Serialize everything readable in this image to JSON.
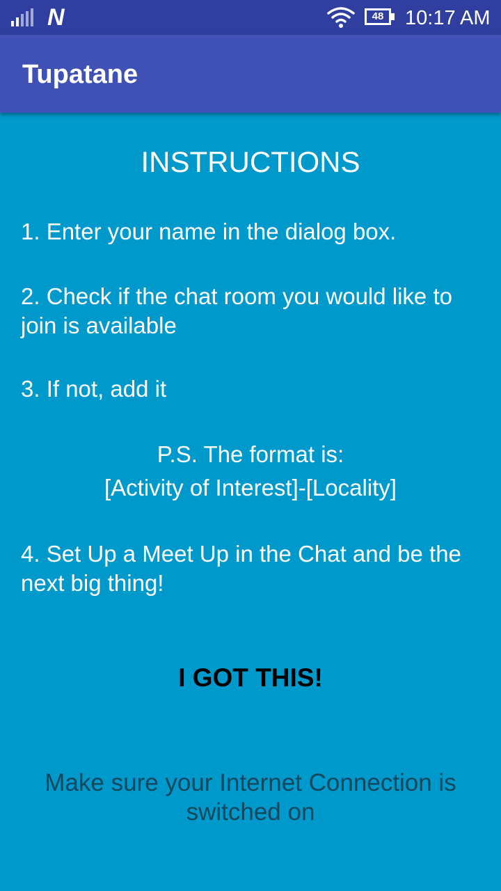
{
  "status_bar": {
    "notification_letter": "N",
    "battery_level": "48",
    "time": "10:17 AM"
  },
  "app_bar": {
    "title": "Tupatane"
  },
  "instructions": {
    "heading": "INSTRUCTIONS",
    "step_1": "1. Enter your name in the dialog box.",
    "step_2": "2. Check if the chat room you would like to join is available",
    "step_3": "3. If not, add it",
    "ps_line_1": "P.S. The format is:",
    "ps_line_2": "[Activity of Interest]-[Locality]",
    "step_4": "4. Set Up a Meet Up in the Chat and be the next big thing!"
  },
  "button": {
    "label": "I GOT THIS!"
  },
  "notice": "Make sure your Internet Connection is switched on",
  "icons": [
    "signal-icon",
    "notification-icon",
    "wifi-icon",
    "battery-icon"
  ],
  "colors": {
    "status_bar": "#303f9f",
    "app_bar": "#3f51b5",
    "background": "#0099cc",
    "notice_text": "#14465c"
  }
}
